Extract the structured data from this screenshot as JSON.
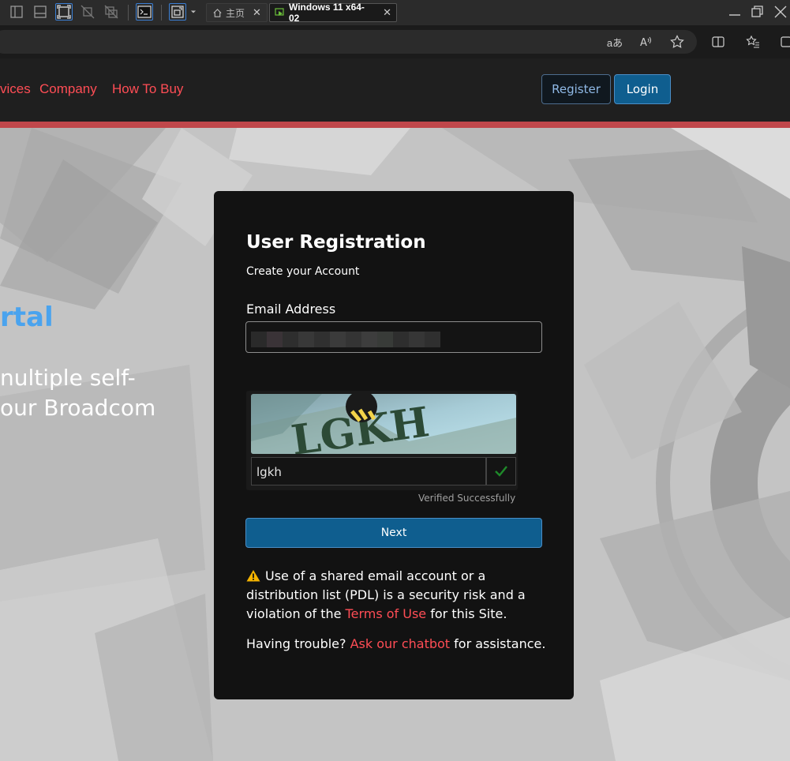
{
  "vm_toolbar": {
    "tabs": [
      {
        "label": "主页",
        "icon": "home-icon"
      },
      {
        "label": "Windows 11 x64-02",
        "icon": "vm-console-icon"
      }
    ],
    "close_glyph": "✕"
  },
  "browser_toolbar": {
    "read_aloud_label": "aあ",
    "text_size_label": "A"
  },
  "site_nav": {
    "items": [
      "vices",
      "Company",
      "How To Buy"
    ],
    "register_label": "Register",
    "login_label": "Login"
  },
  "hero": {
    "title_fragment": "rtal",
    "text_lines": [
      "nultiple self-",
      "our Broadcom"
    ]
  },
  "registration": {
    "title": "User Registration",
    "subtitle": "Create your Account",
    "email_label": "Email Address",
    "captcha": {
      "image_text": "LGKH",
      "input_value": "lgkh",
      "status": "Verified Successfully"
    },
    "next_label": "Next",
    "warning": {
      "part1": "Use of a shared email account or a distribution list (PDL) is a security risk and a violation of the ",
      "link": "Terms of Use",
      "part2": " for this Site."
    },
    "help": {
      "prefix": "Having trouble? ",
      "link": "Ask our chatbot",
      "suffix": " for assistance."
    }
  },
  "colors": {
    "accent_red": "#ff4d55",
    "button_blue": "#0f5e8f",
    "card_bg": "#121212",
    "header_stripe": "#c0474b",
    "hero_link_blue": "#4aa3ee"
  }
}
